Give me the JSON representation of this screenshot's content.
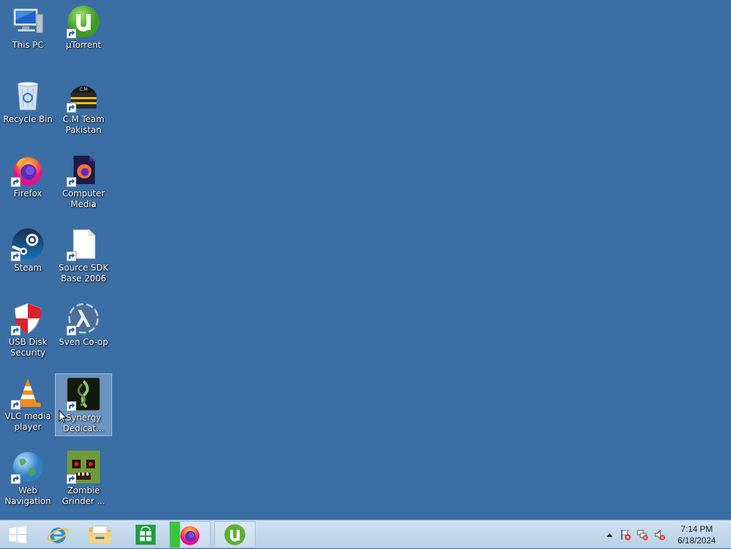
{
  "desktop": {
    "icons": [
      {
        "label": "This PC"
      },
      {
        "label": "µTorrent"
      },
      {
        "label": "Recycle Bin"
      },
      {
        "label": "C.M Team Pakistan"
      },
      {
        "label": "Firefox"
      },
      {
        "label": "Computer Media"
      },
      {
        "label": "Steam"
      },
      {
        "label": "Source SDK Base 2006"
      },
      {
        "label": "USB Disk Security"
      },
      {
        "label": "Sven Co-op"
      },
      {
        "label": "VLC media player"
      },
      {
        "label": "Synergy Dedicat..."
      },
      {
        "label": "Web Navigation"
      },
      {
        "label": "Zombie Grinder ..."
      }
    ]
  },
  "taskbar": {
    "clock": {
      "time": "7:14 PM",
      "date": "6/18/2024"
    },
    "pinned": [
      "start",
      "internet-explorer",
      "file-explorer",
      "store",
      "firefox",
      "utorrent"
    ]
  },
  "colors": {
    "desktop_bg": "#3b6ea5",
    "taskbar_bg": "#c4d9ec",
    "selection": "#cde8ff"
  }
}
